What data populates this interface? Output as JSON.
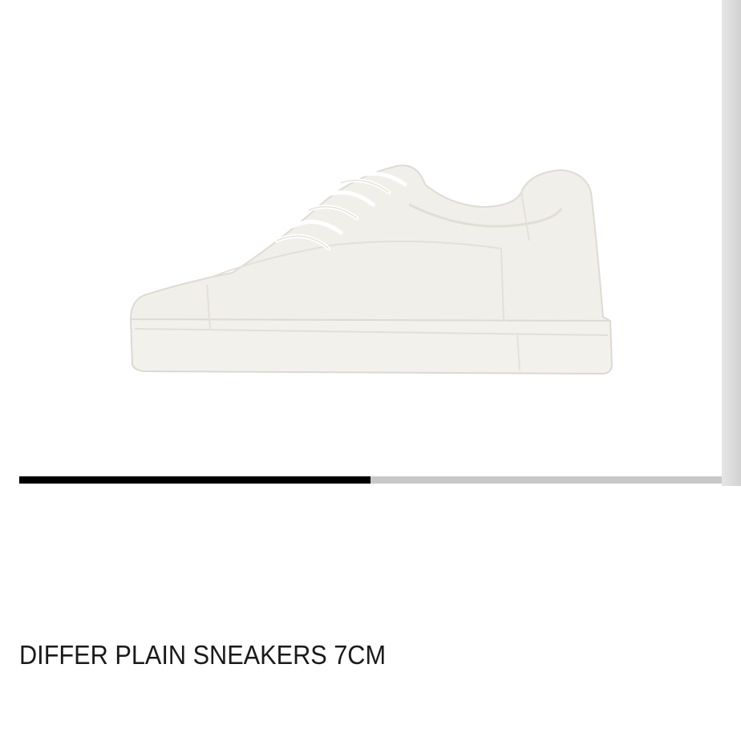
{
  "product": {
    "title": "DIFFER PLAIN SNEAKERS 7CM",
    "image_icon": "sneaker-illustration"
  },
  "gallery": {
    "progress_fraction": 0.5
  },
  "colors": {
    "progress_active": "#000000",
    "progress_track": "#c8c8c8",
    "background": "#ffffff",
    "shoe": "#f1efe9"
  }
}
